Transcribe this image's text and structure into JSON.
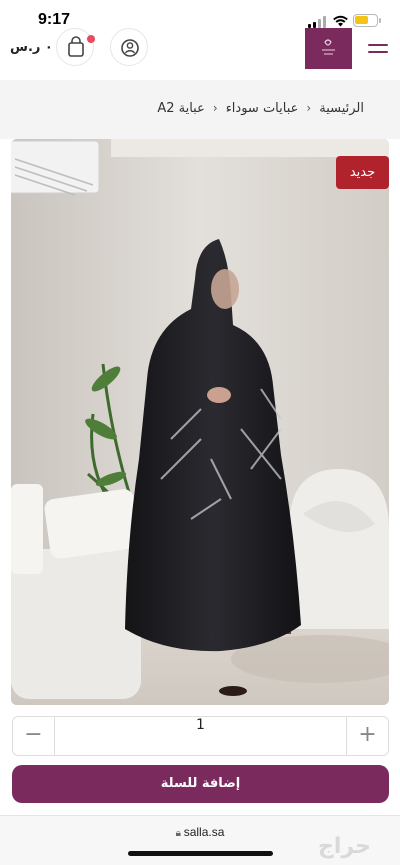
{
  "status_bar": {
    "time": "9:17",
    "battery_level": 0.65
  },
  "header": {
    "price": "٠ ر.س",
    "logo_color": "#7b2a5e",
    "cart_icon": "shopping-bag-icon",
    "account_icon": "user-icon",
    "menu_icon": "hamburger-menu-icon"
  },
  "breadcrumb": {
    "items": [
      "الرئيسية",
      "عبايات سوداء",
      "عباية A2"
    ]
  },
  "product": {
    "badge": "جديد",
    "badge_color": "#b0232d"
  },
  "quantity": {
    "minus": "−",
    "value": "1",
    "plus": "+"
  },
  "add_to_cart": {
    "label": "إضافة للسلة",
    "color": "#7b2a5e"
  },
  "browser": {
    "url": "salla.sa"
  },
  "watermark": "حراج"
}
